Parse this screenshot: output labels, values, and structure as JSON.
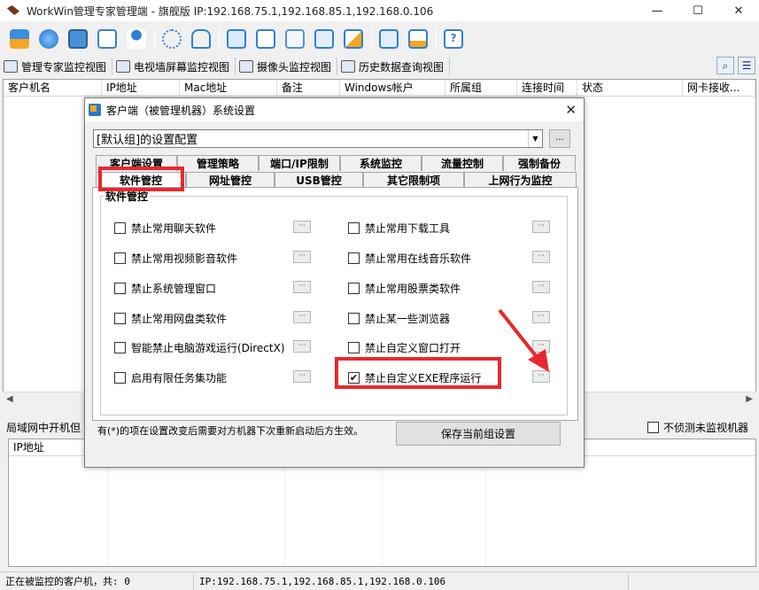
{
  "window": {
    "title": "WorkWin管理专家管理端 - 旗舰版 IP:192.168.75.1,192.168.85.1,192.168.0.106",
    "minimize": "—",
    "maximize": "☐",
    "close": "✕"
  },
  "toolbar": {
    "icons": [
      "monitor-screens-icon",
      "network-globe-icon",
      "computer-settings-icon",
      "bell-alert-icon",
      "user-group-icon",
      "hierarchy-icon",
      "lock-icon",
      "screen-capture-icon",
      "broadcast-icon",
      "search-document-icon",
      "windows-icon",
      "chart-monitor-icon",
      "ip-config-icon",
      "print-alert-icon",
      "help-icon"
    ]
  },
  "view_tabs": [
    {
      "label": "管理专家监控视图",
      "icon": "expert-view-icon"
    },
    {
      "label": "电视墙屏幕监控视图",
      "icon": "tv-wall-icon"
    },
    {
      "label": "摄像头监控视图",
      "icon": "camera-icon"
    },
    {
      "label": "历史数据查询视图",
      "icon": "history-icon"
    }
  ],
  "main_list": {
    "columns": [
      "客户机名",
      "IP地址",
      "Mac地址",
      "备注",
      "Windows帐户",
      "所属组",
      "连接时间",
      "状态",
      "网卡接收..."
    ]
  },
  "lower_panel": {
    "label": "局域网中开机但",
    "checkbox_label": "不侦测未监视机器",
    "column": "IP地址"
  },
  "status_bar": {
    "left": "正在被监控的客户机，共: 0",
    "ip": "IP:192.168.75.1,192.168.85.1,192.168.0.106"
  },
  "dialog": {
    "title": "客户端（被管理机器）系统设置",
    "close": "✕",
    "combo_value": "[默认组]的设置配置",
    "combo_button": "...",
    "tabs_row1": [
      "客户端设置",
      "管理策略",
      "端口/IP限制",
      "系统监控",
      "流量控制",
      "强制备份"
    ],
    "tabs_row2": [
      "软件管控",
      "网址管控",
      "USB管控",
      "其它限制项",
      "上网行为监控"
    ],
    "group_title": "软件管控",
    "options_left": [
      {
        "label": "禁止常用聊天软件",
        "checked": false
      },
      {
        "label": "禁止常用视频影音软件",
        "checked": false
      },
      {
        "label": "禁止系统管理窗口",
        "checked": false
      },
      {
        "label": "禁止常用网盘类软件",
        "checked": false
      },
      {
        "label": "智能禁止电脑游戏运行(DirectX)",
        "checked": false
      },
      {
        "label": "启用有限任务集功能",
        "checked": false
      }
    ],
    "options_right": [
      {
        "label": "禁止常用下载工具",
        "checked": false
      },
      {
        "label": "禁止常用在线音乐软件",
        "checked": false
      },
      {
        "label": "禁止常用股票类软件",
        "checked": false
      },
      {
        "label": "禁止某一些浏览器",
        "checked": false
      },
      {
        "label": "禁止自定义窗口打开",
        "checked": false
      },
      {
        "label": "禁止自定义EXE程序运行",
        "checked": true
      }
    ],
    "mini_button": "···",
    "footnote": "有(*)的项在设置改变后需要对方机器下次重新启动后方生效。",
    "save_button": "保存当前组设置"
  },
  "colors": {
    "highlight": "#e8282f",
    "toolbar_blue": "#2b78c9",
    "toolbar_orange": "#f5a623"
  }
}
